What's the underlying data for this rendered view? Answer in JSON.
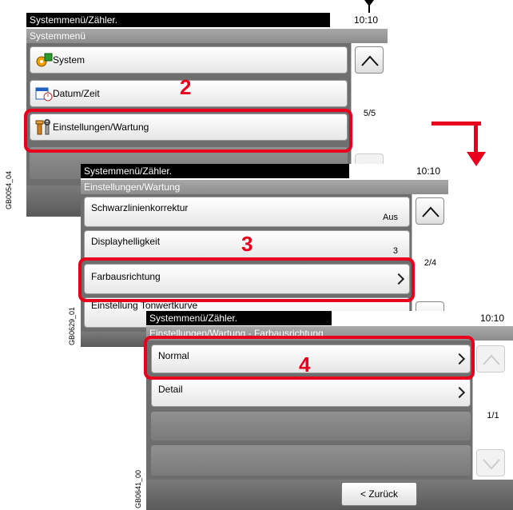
{
  "screen1": {
    "title": "Systemmenü/Zähler.",
    "time": "10:10",
    "subtitle": "Systemmenü",
    "items": [
      {
        "label": "System",
        "icon": "system-icon"
      },
      {
        "label": "Datum/Zeit",
        "icon": "calendar-clock-icon"
      },
      {
        "label": "Einstellungen/Wartung",
        "icon": "wrench-icon"
      }
    ],
    "page": "5/5",
    "step": "2",
    "side_id": "GB0054_04"
  },
  "screen2": {
    "title": "Systemmenü/Zähler.",
    "time": "10:10",
    "subtitle": "Einstellungen/Wartung",
    "items": [
      {
        "label": "Schwarzlinienkorrektur",
        "value": "Aus"
      },
      {
        "label": "Displayhelligkeit",
        "value": "3"
      },
      {
        "label": "Farbausrichtung",
        "value": ""
      },
      {
        "label": "Einstellung Tonwertkurve",
        "value": ""
      }
    ],
    "page": "2/4",
    "step": "3",
    "side_id": "GB0629_01"
  },
  "screen3": {
    "title": "Systemmenü/Zähler.",
    "time": "10:10",
    "subtitle": "Einstellungen/Wartung - Farbausrichtung",
    "items": [
      {
        "label": "Normal"
      },
      {
        "label": "Detail"
      }
    ],
    "page": "1/1",
    "step": "4",
    "back_label": "< Zurück",
    "side_id": "GB0641_00"
  },
  "colors": {
    "highlight": "#e8001c"
  }
}
